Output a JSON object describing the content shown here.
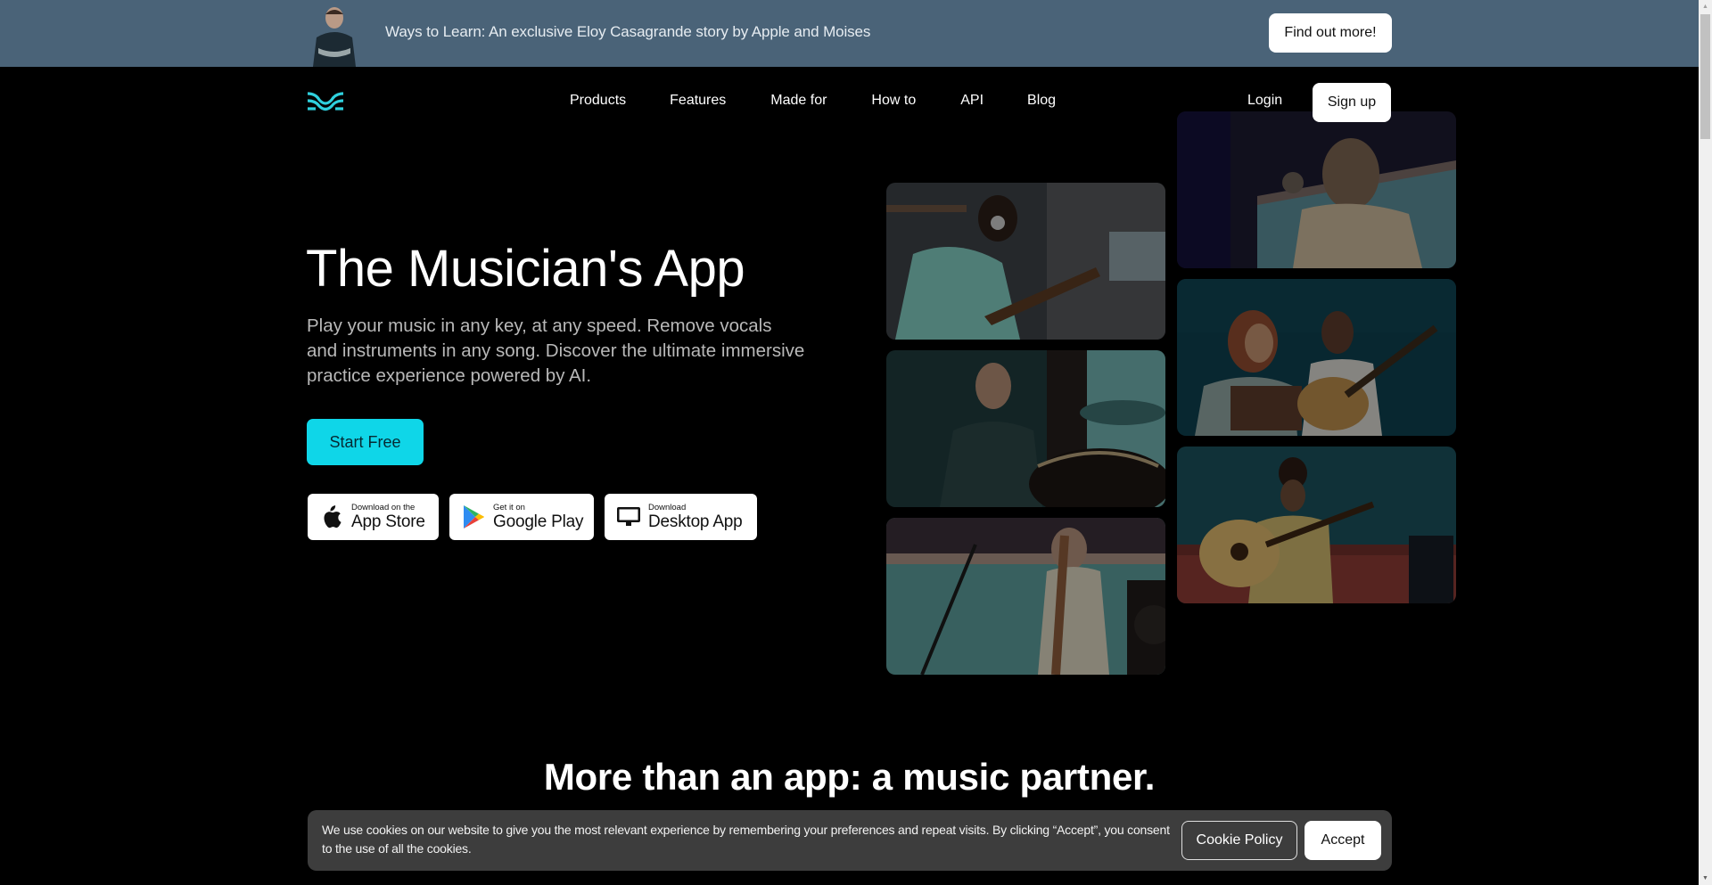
{
  "promo": {
    "text": "Ways to Learn: An exclusive Eloy Casagrande story by Apple and Moises",
    "button": "Find out more!",
    "avatar_icon": "person-portrait"
  },
  "nav": {
    "logo_icon": "moises-wave-logo",
    "links": [
      "Products",
      "Features",
      "Made for",
      "How to",
      "API",
      "Blog"
    ],
    "login": "Login",
    "signup": "Sign up"
  },
  "hero": {
    "title": "The Musician's App",
    "subtitle": "Play your music in any key, at any speed. Remove vocals and instruments in any song. Discover the ultimate immersive practice experience powered by AI.",
    "cta": "Start Free",
    "stores": [
      {
        "small": "Download on the",
        "big": "App Store",
        "icon": "apple-icon"
      },
      {
        "small": "Get it on",
        "big": "Google Play",
        "icon": "google-play-icon"
      },
      {
        "small": "Download",
        "big": "Desktop App",
        "icon": "desktop-monitor-icon"
      }
    ],
    "tiles": [
      "Musician with headphones playing bass in studio",
      "Drummer in studio",
      "Guitarist at microphone stand",
      "Singer at microphone",
      "Duo with tablet and acoustic guitar",
      "Woman playing acoustic guitar on sofa"
    ]
  },
  "section": {
    "title": "More than an app: a music partner."
  },
  "cookie": {
    "text": "We use cookies on our website to give you the most relevant experience by remembering your preferences and repeat visits. By clicking “Accept”, you consent to the use of all the cookies.",
    "policy": "Cookie Policy",
    "accept": "Accept"
  },
  "colors": {
    "promo_bg": "#4a6378",
    "accent": "#0fd6e8",
    "cookie_bg": "#3d3d3d",
    "page_bg": "#000000"
  }
}
